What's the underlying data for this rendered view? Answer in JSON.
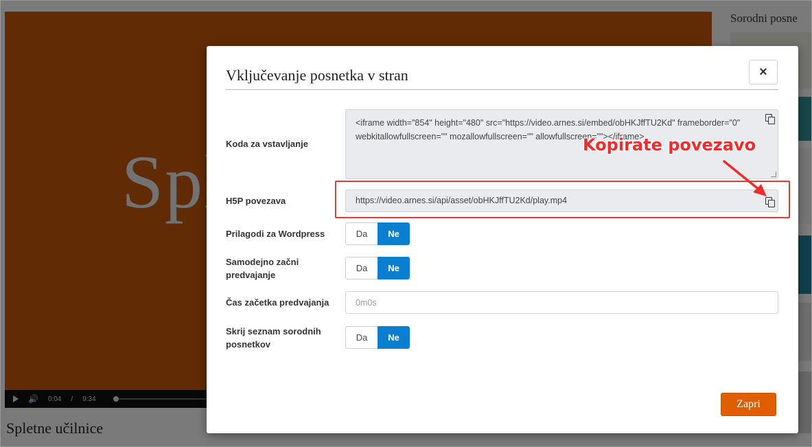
{
  "background": {
    "video_text": "Spl",
    "time_current": "0:04",
    "time_sep": "/",
    "time_total": "9:34",
    "page_title": "Spletne učilnice",
    "sidebar_title": "Sorodni posne"
  },
  "modal": {
    "title": "Vključevanje posnetka v stran",
    "close_label": "×",
    "embed": {
      "label": "Koda za vstavljanje",
      "value": "<iframe width=\"854\" height=\"480\" src=\"https://video.arnes.si/embed/obHKJffTU2Kd\" frameborder=\"0\" webkitallowfullscreen=\"\" mozallowfullscreen=\"\" allowfullscreen=\"\"></iframe>"
    },
    "h5p": {
      "label": "H5P povezava",
      "value": "https://video.arnes.si/api/asset/obHKJffTU2Kd/play.mp4"
    },
    "wordpress": {
      "label": "Prilagodi za Wordpress",
      "yes": "Da",
      "no": "Ne",
      "selected": "Ne"
    },
    "autoplay": {
      "label": "Samodejno začni predvajanje",
      "yes": "Da",
      "no": "Ne",
      "selected": "Ne"
    },
    "start_time": {
      "label": "Čas začetka predvajanja",
      "placeholder": "0m0s"
    },
    "hide_related": {
      "label": "Skrij seznam sorodnih posnetkov",
      "yes": "Da",
      "no": "Ne",
      "selected": "Ne"
    },
    "close_button": "Zapri"
  },
  "annotation": {
    "callout": "Kopirate povezavo",
    "color": "#e53935"
  },
  "colors": {
    "accent_blue": "#0b7fcf",
    "primary_orange": "#e05d00",
    "video_orange": "#c0560b"
  }
}
